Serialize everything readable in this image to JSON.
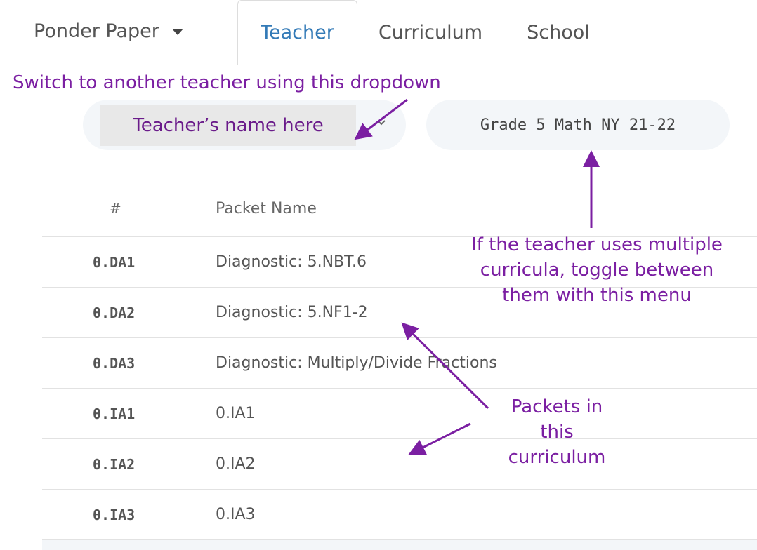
{
  "nav": {
    "brand": "Ponder Paper",
    "tabs": [
      {
        "label": "Teacher",
        "active": true
      },
      {
        "label": "Curriculum",
        "active": false
      },
      {
        "label": "School",
        "active": false
      }
    ]
  },
  "selectors": {
    "teacher_value": "Teacher’s name here",
    "curriculum_value": "Grade 5 Math NY 21-22"
  },
  "table": {
    "headers": {
      "number": "#",
      "name": "Packet Name"
    },
    "rows": [
      {
        "code": "0.DA1",
        "name": "Diagnostic: 5.NBT.6"
      },
      {
        "code": "0.DA2",
        "name": "Diagnostic: 5.NF1-2"
      },
      {
        "code": "0.DA3",
        "name": "Diagnostic: Multiply/Divide Fractions"
      },
      {
        "code": "0.IA1",
        "name": "0.IA1"
      },
      {
        "code": "0.IA2",
        "name": "0.IA2"
      },
      {
        "code": "0.IA3",
        "name": "0.IA3"
      }
    ]
  },
  "annotations": {
    "switch": "Switch to another teacher using this dropdown",
    "curricula_lines": [
      "If the teacher uses multiple",
      "curricula, toggle between",
      "them with this menu"
    ],
    "packets_lines": [
      "Packets in",
      "this",
      "curriculum"
    ]
  },
  "colors": {
    "annotation": "#7b1fa2",
    "active_tab": "#337ab7",
    "pill_bg": "#f3f6f9"
  },
  "icons": {
    "brand_caret": "caret-down-icon",
    "teacher_select": "chevron-down-icon"
  }
}
